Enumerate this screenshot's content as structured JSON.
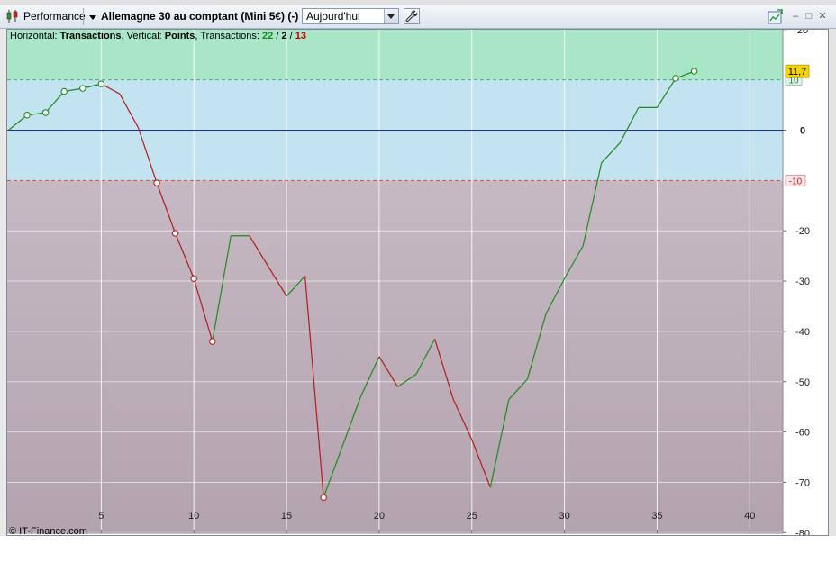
{
  "toolbar": {
    "app_label": "Performance",
    "symbol_label": "Allemagne 30 au comptant (Mini 5€) (-)",
    "period_value": "Aujourd'hui",
    "minimize": "‒",
    "maximize": "□",
    "close": "✕"
  },
  "header": {
    "horizontal_label": "Horizontal: ",
    "horizontal_value": "Transactions",
    "vertical_label": ", Vertical: ",
    "vertical_value": "Points",
    "transactions_label": ", Transactions: ",
    "total": "22",
    "slash1": " / ",
    "neutral": "2",
    "slash2": " / ",
    "losses": "13"
  },
  "copyright": "© IT-Finance.com",
  "colors": {
    "profit_zone": "#a8e6c7",
    "neutral_zone": "#c3e3f1",
    "loss_zone": "#c1b3bd",
    "win_line": "#1e8a1e",
    "loss_line": "#b31c1c",
    "zero_line": "#1a2f9c",
    "last_badge": "#f5d20a"
  },
  "chart_data": {
    "type": "line",
    "title": "",
    "xlabel": "",
    "ylabel": "",
    "xlim": [
      0,
      42
    ],
    "ylim": [
      -80,
      20
    ],
    "x_ticks": [
      5,
      10,
      15,
      20,
      25,
      30,
      35,
      40
    ],
    "y_ticks": [
      20,
      10,
      0,
      -10,
      -20,
      -30,
      -40,
      -50,
      -60,
      -70,
      -80
    ],
    "zones": {
      "upper": 10,
      "lower": -10
    },
    "last_value_label": "11,7",
    "upper_label": "10",
    "lower_label": "-10",
    "zero_label": "0",
    "x": [
      0,
      1,
      2,
      3,
      4,
      5,
      6,
      7,
      8,
      9,
      10,
      11,
      12,
      13,
      14,
      15,
      16,
      17,
      18,
      19,
      20,
      21,
      22,
      23,
      24,
      25,
      26,
      27,
      28,
      29,
      30,
      31,
      32,
      33,
      34,
      35,
      36,
      37
    ],
    "values": [
      0,
      3,
      3.5,
      7.7,
      8.3,
      9.2,
      7.2,
      0.5,
      -10.5,
      -20.5,
      -29.5,
      -42,
      -21,
      -21,
      -27,
      -33,
      -29,
      -73,
      -63,
      -53,
      -45,
      -51,
      -48.5,
      -41.5,
      -53.5,
      -61.5,
      -71,
      -53.5,
      -49.5,
      -36.5,
      -29.5,
      -23,
      -6.5,
      -2.5,
      4.5,
      4.5,
      10.3,
      11.7
    ],
    "segment_colors": [
      "g",
      "g",
      "g",
      "g",
      "g",
      "r",
      "r",
      "r",
      "r",
      "r",
      "r",
      "g",
      "g",
      "r",
      "r",
      "g",
      "r",
      "g",
      "g",
      "g",
      "r",
      "g",
      "g",
      "r",
      "r",
      "r",
      "g",
      "g",
      "g",
      "g",
      "g",
      "g",
      "g",
      "g",
      "g",
      "g",
      "g"
    ],
    "markers": [
      1,
      2,
      3,
      4,
      5,
      8,
      9,
      10,
      11,
      17,
      36,
      37
    ],
    "marker_colors": [
      "g",
      "g",
      "g",
      "g",
      "g",
      "r",
      "r",
      "r",
      "r",
      "r",
      "g",
      "g"
    ]
  }
}
